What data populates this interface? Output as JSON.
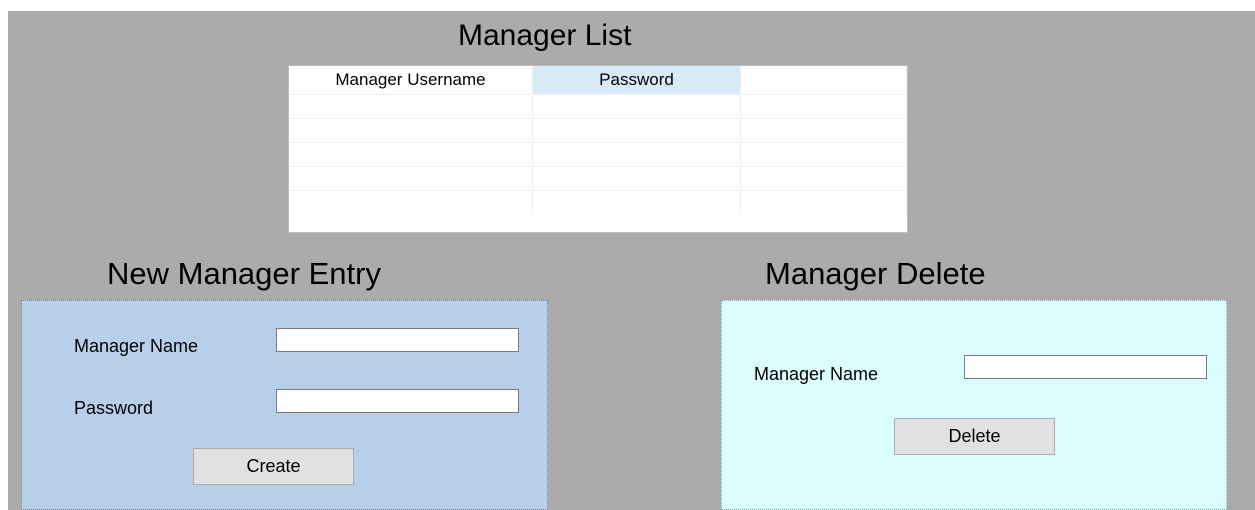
{
  "manager_list": {
    "title": "Manager List",
    "columns": [
      "Manager Username",
      "Password",
      ""
    ],
    "rows": [
      [
        "",
        "",
        ""
      ],
      [
        "",
        "",
        ""
      ],
      [
        "",
        "",
        ""
      ],
      [
        "",
        "",
        ""
      ],
      [
        "",
        "",
        ""
      ]
    ]
  },
  "new_entry": {
    "title": "New Manager Entry",
    "name_label": "Manager Name",
    "name_value": "",
    "password_label": "Password",
    "password_value": "",
    "create_label": "Create"
  },
  "delete_section": {
    "title": "Manager Delete",
    "name_label": "Manager Name",
    "name_value": "",
    "delete_label": "Delete"
  },
  "colors": {
    "form_background": "#ababab",
    "entry_panel": "#b8cfe9",
    "delete_panel": "#dcfdfd",
    "selected_header": "#d9eaf7"
  }
}
